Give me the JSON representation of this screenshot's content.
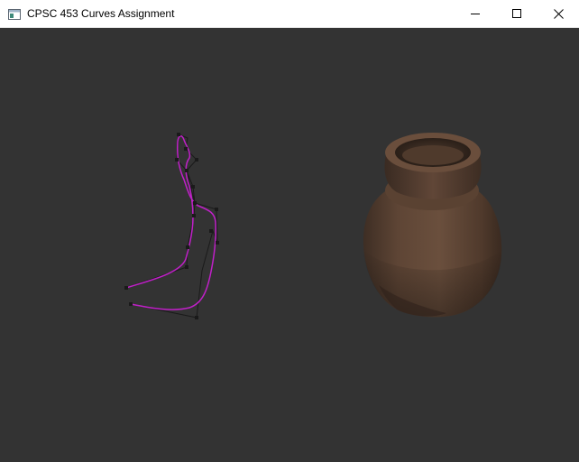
{
  "window": {
    "title": "CPSC 453 Curves Assignment",
    "icon": "app-window-icon",
    "controls": {
      "minimize_icon": "minimize-icon",
      "maximize_icon": "maximize-icon",
      "close_icon": "close-icon"
    }
  },
  "viewport": {
    "background_color": "#333333",
    "curve_color": "#c020c8",
    "control_polygon_color": "#1a1a1a",
    "control_point_color": "#1a1a1a",
    "vase_base_color": "#5a4232",
    "vase_shadow_color": "#3a2a20",
    "vase_highlight_color": "#7a5e4a"
  }
}
